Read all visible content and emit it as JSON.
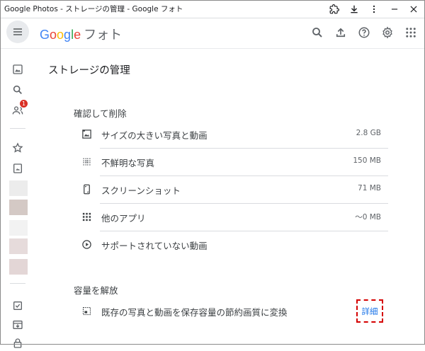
{
  "window": {
    "title": "Google Photos - ストレージの管理 - Google フォト"
  },
  "app": {
    "logo_letters": [
      "G",
      "o",
      "o",
      "g",
      "l",
      "e"
    ],
    "product_name": "フォト"
  },
  "sidebar": {
    "sharing_badge": "1"
  },
  "page": {
    "title": "ストレージの管理"
  },
  "review": {
    "title": "確認して削除",
    "items": [
      {
        "label": "サイズの大きい写真と動画",
        "size": "2.8 GB"
      },
      {
        "label": "不鮮明な写真",
        "size": "150 MB"
      },
      {
        "label": "スクリーンショット",
        "size": "71 MB"
      },
      {
        "label": "他のアプリ",
        "size": "～0 MB"
      },
      {
        "label": "サポートされていない動画",
        "size": ""
      }
    ]
  },
  "free_up": {
    "title": "容量を解放",
    "item_label": "既存の写真と動画を保存容量の節約画質に変換",
    "details_link": "詳細"
  },
  "colors": {
    "accent": "#1a73e8",
    "badge": "#d93025",
    "highlight_border": "#d50000"
  }
}
